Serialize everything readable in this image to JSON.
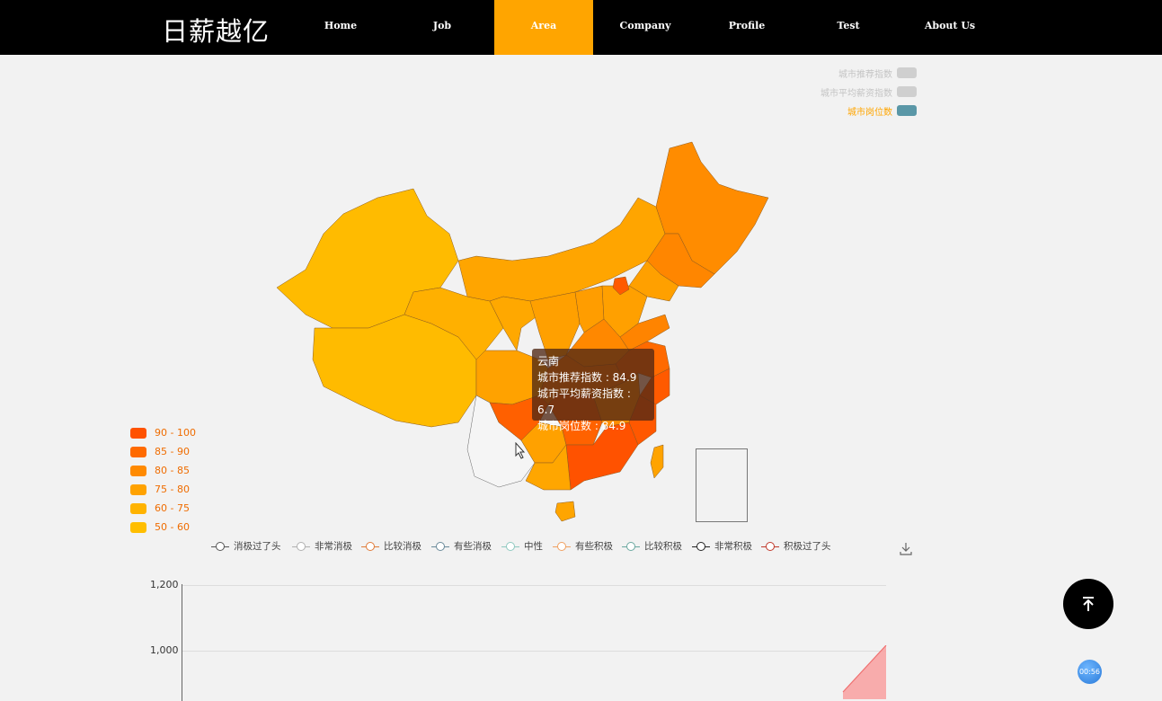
{
  "header": {
    "logo": "日薪越亿",
    "nav": [
      "Home",
      "Job",
      "Area",
      "Company",
      "Profile",
      "Test",
      "About Us"
    ],
    "active_nav": "Area"
  },
  "map_legend": {
    "items": [
      "城市推荐指数",
      "城市平均薪资指数",
      "城市岗位数"
    ],
    "selected": "城市岗位数"
  },
  "visual_map": [
    {
      "label": "90 - 100",
      "color": "#ff5200"
    },
    {
      "label": "85 - 90",
      "color": "#ff6a00"
    },
    {
      "label": "80 - 85",
      "color": "#ff8a00"
    },
    {
      "label": "75 - 80",
      "color": "#ffa200"
    },
    {
      "label": "60 - 75",
      "color": "#ffb300"
    },
    {
      "label": "50 - 60",
      "color": "#ffbe00"
    }
  ],
  "tooltip": {
    "region": "云南",
    "line1": "城市推荐指数 : 84.9",
    "line2": "城市平均薪资指数 : 6.7",
    "line3": "城市岗位数 : 84.9"
  },
  "sentiment_legend": [
    {
      "label": "消极过了头",
      "color": "#555555"
    },
    {
      "label": "非常消极",
      "color": "#b0b0b0"
    },
    {
      "label": "比较消极",
      "color": "#e07b39"
    },
    {
      "label": "有些消极",
      "color": "#6a8a9a"
    },
    {
      "label": "中性",
      "color": "#8fc9c0"
    },
    {
      "label": "有些积极",
      "color": "#f0a060"
    },
    {
      "label": "比较积极",
      "color": "#6aa8a0"
    },
    {
      "label": "非常积极",
      "color": "#222222"
    },
    {
      "label": "积极过了头",
      "color": "#c0392b"
    }
  ],
  "chart_data": {
    "type": "area",
    "y_ticks": [
      "1,200",
      "1,000"
    ],
    "series_visible_color": "#f88a8a"
  },
  "widgets": {
    "timer": "00:56",
    "backtop_icon": "arrow-up-to-line-icon",
    "download_icon": "download-icon"
  }
}
